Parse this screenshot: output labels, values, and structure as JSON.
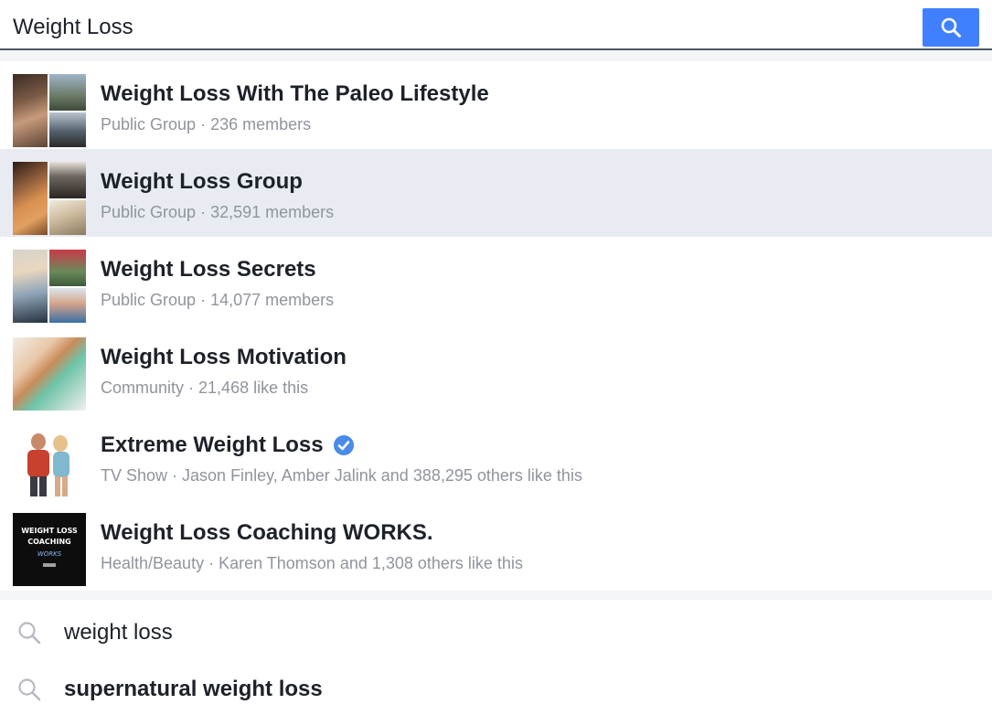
{
  "search": {
    "value": "Weight Loss",
    "accent": "#4080ff"
  },
  "results": [
    {
      "title": "Weight Loss With The Paleo Lifestyle",
      "type": "Public Group",
      "detail": "236 members",
      "verified": false
    },
    {
      "title": "Weight Loss Group",
      "type": "Public Group",
      "detail": "32,591 members",
      "verified": false,
      "highlighted": true
    },
    {
      "title": "Weight Loss Secrets",
      "type": "Public Group",
      "detail": "14,077 members",
      "verified": false
    },
    {
      "title": "Weight Loss Motivation",
      "type": "Community",
      "detail": "21,468 like this",
      "verified": false
    },
    {
      "title": "Extreme Weight Loss",
      "type": "TV Show",
      "detail": "Jason Finley, Amber Jalink and 388,295 others like this",
      "verified": true
    },
    {
      "title": "Weight Loss Coaching WORKS.",
      "type": "Health/Beauty",
      "detail": "Karen Thomson and 1,308 others like this",
      "verified": false
    }
  ],
  "logo_text": {
    "line1": "WEIGHT LOSS",
    "line2": "COACHING",
    "line3": "WORKS"
  },
  "suggestions": [
    {
      "text": "weight loss",
      "bold": false
    },
    {
      "text": "supernatural weight loss",
      "bold": true
    }
  ],
  "separator": " · "
}
